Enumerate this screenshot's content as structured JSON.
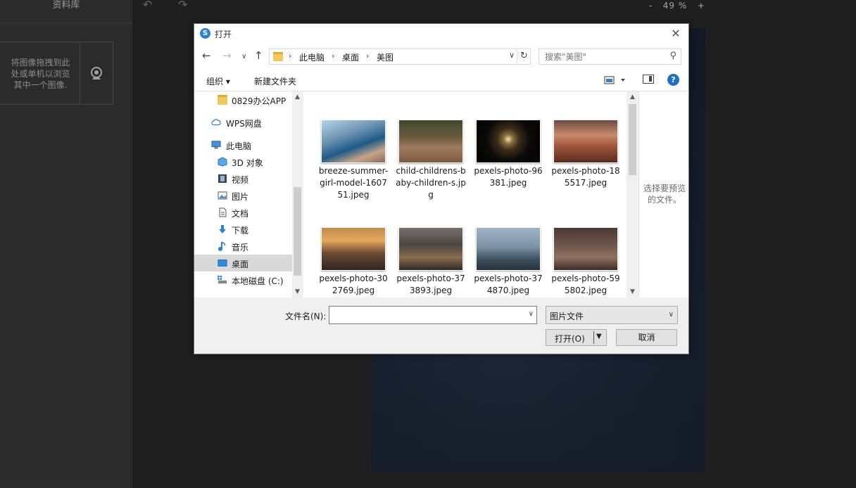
{
  "app": {
    "library_title": "资料库",
    "drop_hint": [
      "将图像拖拽到此",
      "处或单机以浏览",
      "其中一个图像."
    ],
    "undo_icon": "undo-icon",
    "redo_icon": "redo-icon",
    "zoom": {
      "minus": "-",
      "value": "49 %",
      "plus": "+"
    }
  },
  "dialog": {
    "title": "打开",
    "breadcrumb": [
      "此电脑",
      "桌面",
      "美图"
    ],
    "search_placeholder": "搜索\"美图\"",
    "toolbar": {
      "organize": "组织 ▾",
      "new_folder": "新建文件夹",
      "help": "?"
    },
    "nav_items": [
      {
        "label": "0829办公APP",
        "icon": "folder-icon"
      },
      {
        "label": "WPS网盘",
        "icon": "cloud-icon"
      },
      {
        "label": "此电脑",
        "icon": "computer-icon"
      },
      {
        "label": "3D 对象",
        "icon": "cube-icon"
      },
      {
        "label": "视频",
        "icon": "video-icon"
      },
      {
        "label": "图片",
        "icon": "picture-icon"
      },
      {
        "label": "文档",
        "icon": "document-icon"
      },
      {
        "label": "下载",
        "icon": "download-icon"
      },
      {
        "label": "音乐",
        "icon": "music-icon"
      },
      {
        "label": "桌面",
        "icon": "desktop-icon",
        "selected": true
      },
      {
        "label": "本地磁盘 (C:)",
        "icon": "drive-icon"
      }
    ],
    "files": [
      {
        "name": "breeze-summer-girl-model-160751.jpeg"
      },
      {
        "name": "child-childrens-baby-children-s.jpg"
      },
      {
        "name": "pexels-photo-96381.jpeg"
      },
      {
        "name": "pexels-photo-185517.jpeg"
      },
      {
        "name": "pexels-photo-302769.jpeg"
      },
      {
        "name": "pexels-photo-373893.jpeg"
      },
      {
        "name": "pexels-photo-374870.jpeg"
      },
      {
        "name": "pexels-photo-595802.jpeg"
      }
    ],
    "preview_text": "选择要预览的文件。",
    "filename_label": "文件名(N):",
    "filename_value": "",
    "file_type": "图片文件",
    "open_label": "打开(O)",
    "cancel_label": "取消"
  }
}
